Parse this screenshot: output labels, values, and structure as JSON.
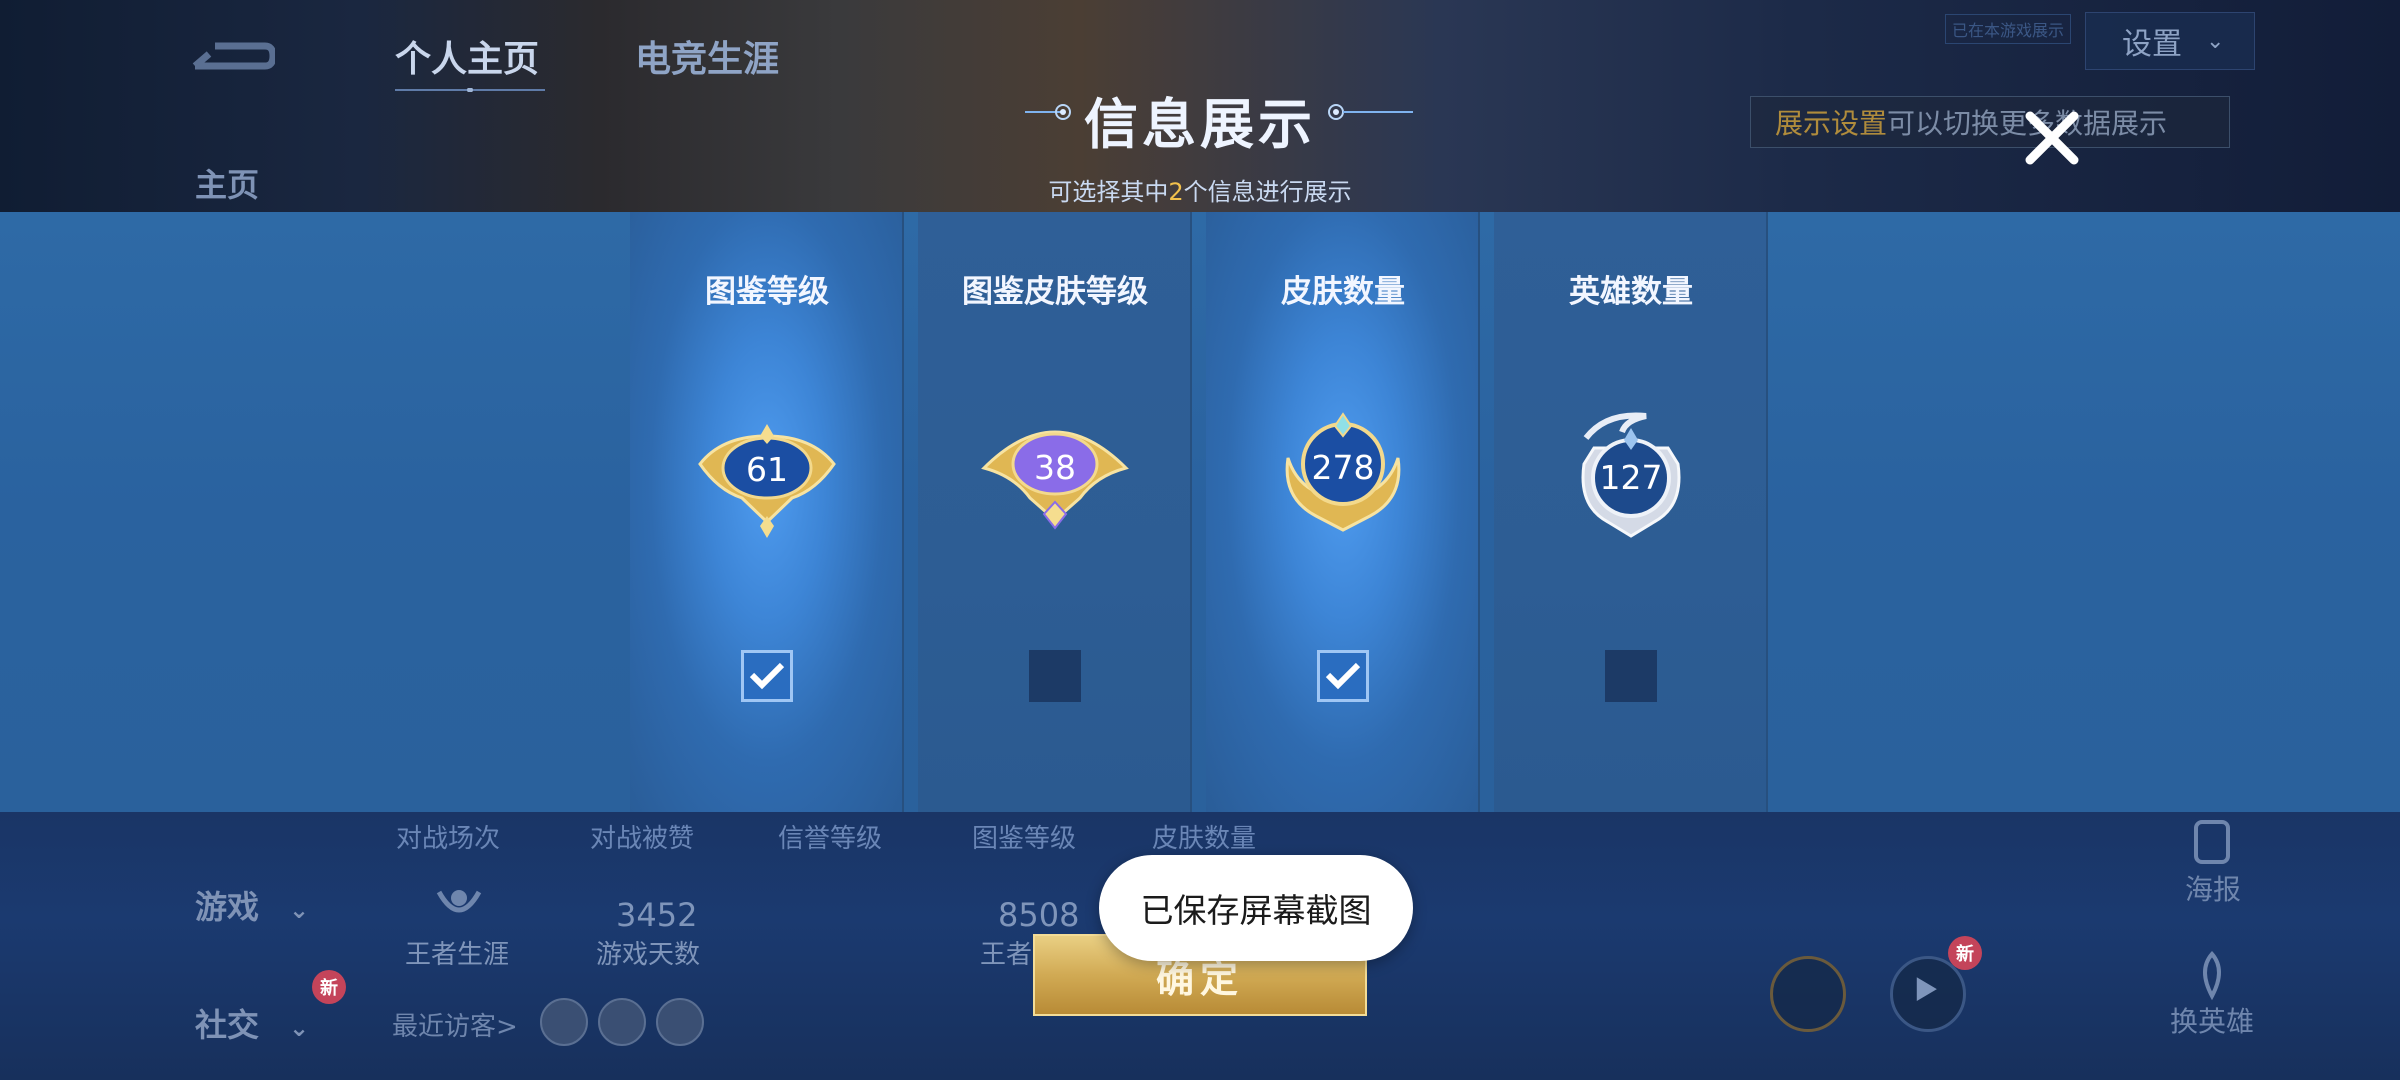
{
  "background": {
    "tabs": [
      "个人主页",
      "电竞生涯"
    ],
    "sidebar": [
      "主页",
      "游戏",
      "社交"
    ],
    "settings_label": "设置",
    "top_note": "已在本游戏展示",
    "tip_highlight": "展示设置",
    "tip_text": "可以切换更多数据展示",
    "stats": [
      {
        "label": "对战场次"
      },
      {
        "label": "对战被赞",
        "value": "3452",
        "sub": "游戏天数"
      },
      {
        "label": "信誉等级"
      },
      {
        "label": "图鉴等级",
        "value": "8508",
        "sub": "王者"
      },
      {
        "label": "皮肤数量"
      }
    ],
    "career_label": "王者生涯",
    "visitors_label": "最近访客>",
    "new_badge": "新",
    "poster_label": "海报",
    "switch_hero_label": "换英雄"
  },
  "modal": {
    "title": "信息展示",
    "subtitle_pre": "可选择其中",
    "subtitle_num": "2",
    "subtitle_post": "个信息进行展示",
    "cards": [
      {
        "title": "图鉴等级",
        "value": "61",
        "checked": true,
        "color": "#d8b04c"
      },
      {
        "title": "图鉴皮肤等级",
        "value": "38",
        "checked": false,
        "color": "#8c74e6"
      },
      {
        "title": "皮肤数量",
        "value": "278",
        "checked": true,
        "color": "#d8b04c"
      },
      {
        "title": "英雄数量",
        "value": "127",
        "checked": false,
        "color": "#d4dae6"
      }
    ],
    "confirm_label": "确定"
  },
  "toast": {
    "text": "已保存屏幕截图"
  }
}
